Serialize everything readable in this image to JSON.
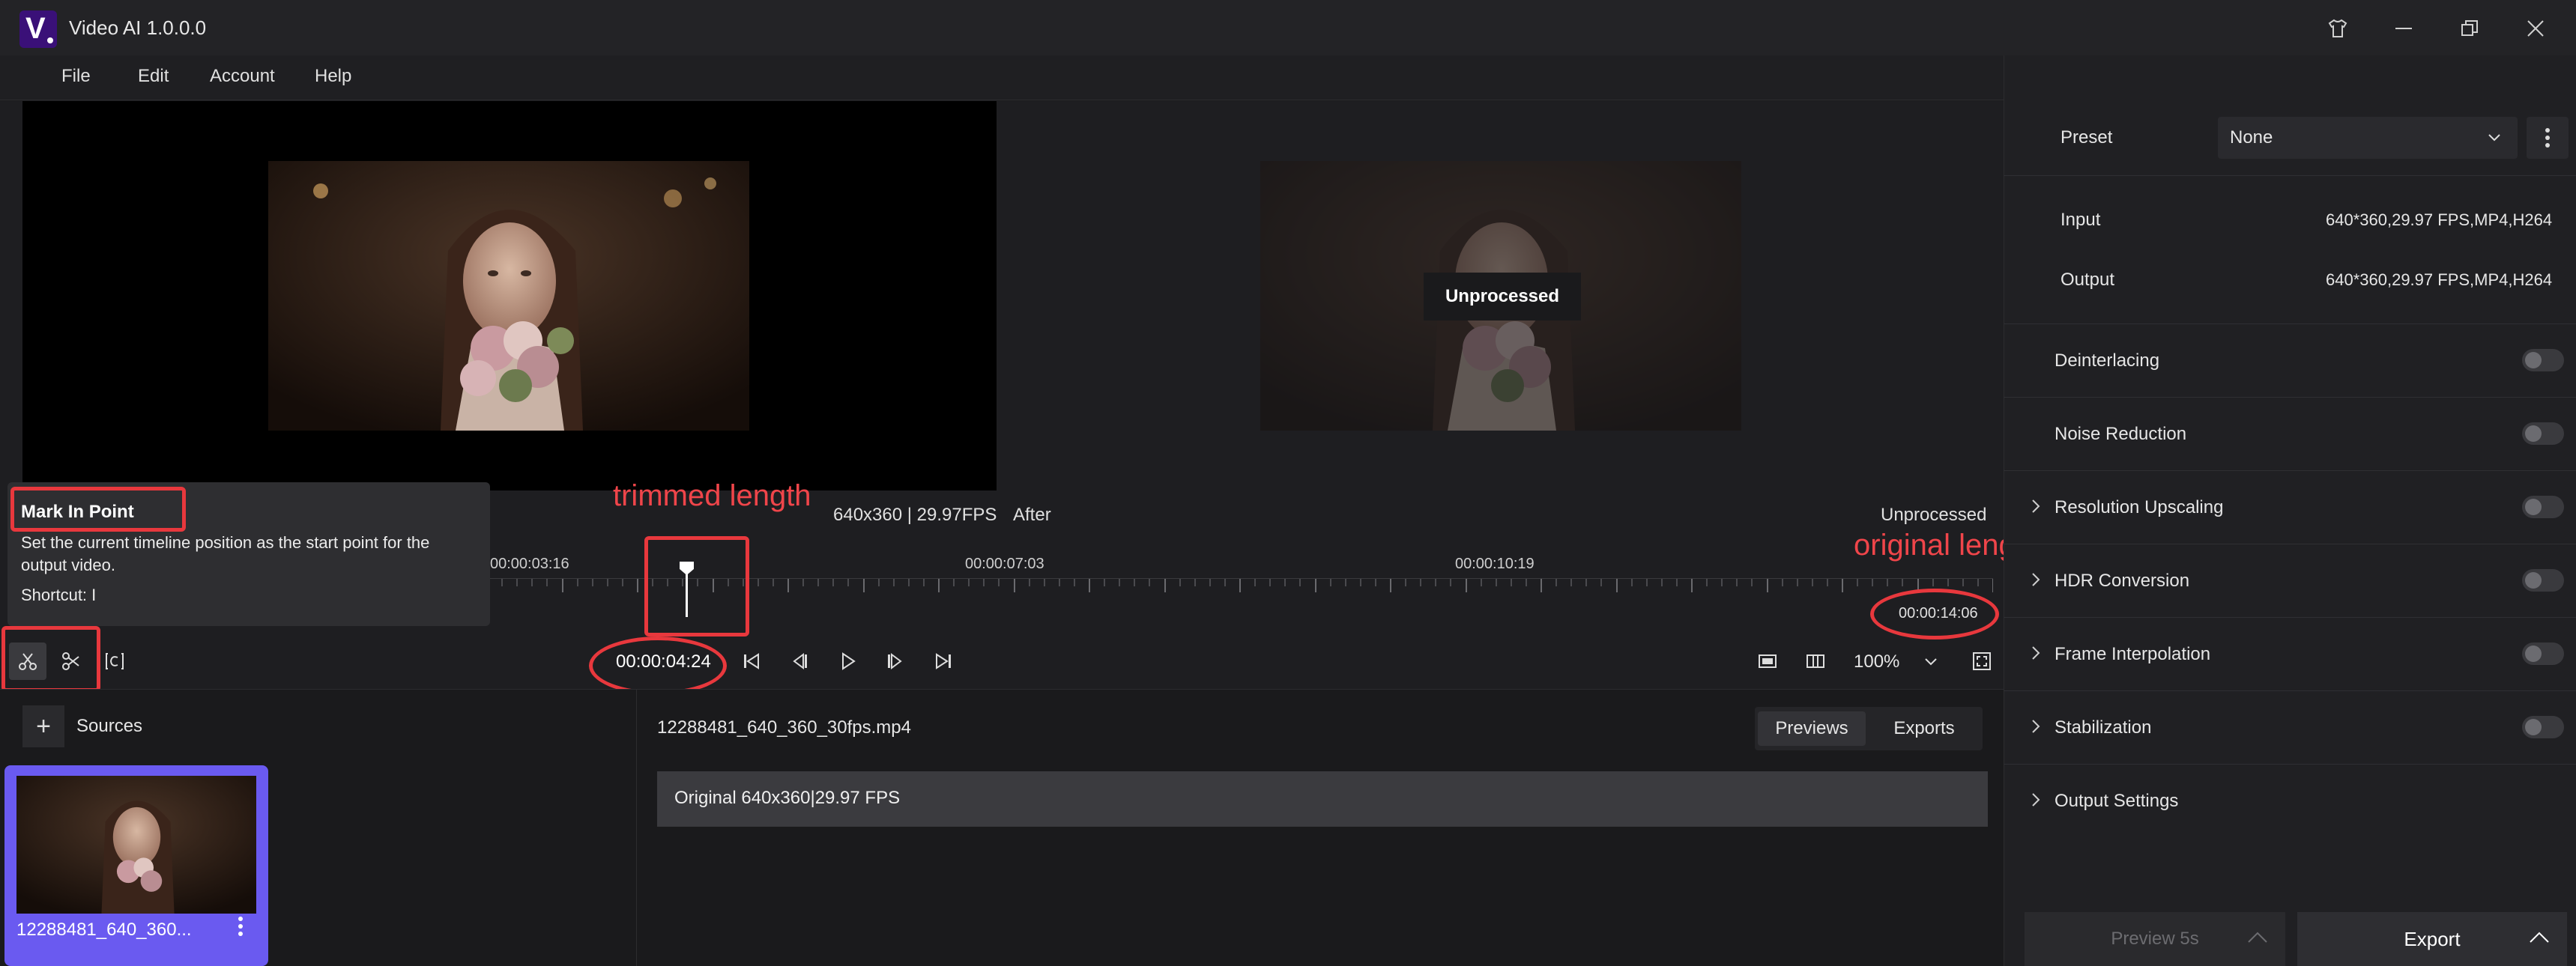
{
  "window": {
    "app_logo_letter": "V",
    "title": "Video AI 1.0.0.0"
  },
  "menu": {
    "items": [
      "File",
      "Edit",
      "Account",
      "Help"
    ]
  },
  "preview": {
    "unprocessed_badge": "Unprocessed",
    "info": "640x360 | 29.97FPS",
    "after_label": "After",
    "status_right": "Unprocessed"
  },
  "tooltip": {
    "title": "Mark In Point",
    "description": "Set the current timeline position as the start point for the output video.",
    "shortcut": "Shortcut: I"
  },
  "timeline": {
    "ticks": [
      "00:00:03:16",
      "00:00:07:03",
      "00:00:10:19"
    ],
    "end_time": "00:00:14:06",
    "current_time": "00:00:04:24",
    "playhead_progress": 0.35,
    "zoom": "100%"
  },
  "annotations": {
    "trimmed": "trimmed length",
    "original": "original length"
  },
  "sources": {
    "add_icon": "+",
    "label": "Sources",
    "items": [
      {
        "name": "12288481_640_360..."
      }
    ]
  },
  "main": {
    "file_name": "12288481_640_360_30fps.mp4",
    "tabs": [
      "Previews",
      "Exports"
    ],
    "original_row": "Original 640x360|29.97 FPS"
  },
  "panel": {
    "preset_label": "Preset",
    "preset_value": "None",
    "input_label": "Input",
    "input_value": "640*360,29.97 FPS,MP4,H264",
    "output_label": "Output",
    "output_value": "640*360,29.97 FPS,MP4,H264",
    "deinterlacing": "Deinterlacing",
    "noise_reduction": "Noise Reduction",
    "sections": [
      "Resolution Upscaling",
      "HDR Conversion",
      "Frame Interpolation",
      "Stabilization"
    ],
    "output_settings": "Output Settings",
    "preview_button": "Preview 5s",
    "export_button": "Export"
  },
  "colors": {
    "accent": "#6a5af0",
    "annotation": "#e8383d",
    "logo": "#3a1078"
  }
}
